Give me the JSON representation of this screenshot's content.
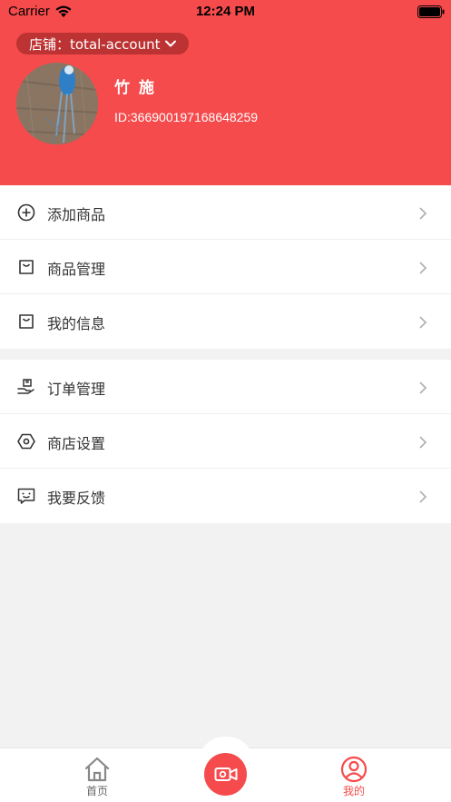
{
  "status_bar": {
    "carrier": "Carrier",
    "time": "12:24 PM"
  },
  "header": {
    "shop_label": "店铺：total-account",
    "user_name": "竹 施",
    "user_id": "ID:366900197168648259",
    "accent_color": "#f64b4c"
  },
  "menu_groups": [
    {
      "items": [
        {
          "label": "添加商品",
          "icon": "plus-circle-icon"
        },
        {
          "label": "商品管理",
          "icon": "bag-icon"
        },
        {
          "label": "我的信息",
          "icon": "bag-icon"
        }
      ]
    },
    {
      "items": [
        {
          "label": "订单管理",
          "icon": "hand-box-icon"
        },
        {
          "label": "商店设置",
          "icon": "hex-settings-icon"
        },
        {
          "label": "我要反馈",
          "icon": "feedback-chat-icon"
        }
      ]
    }
  ],
  "tabbar": {
    "home_label": "首页",
    "mine_label": "我的",
    "center_icon": "video-camera-icon"
  }
}
